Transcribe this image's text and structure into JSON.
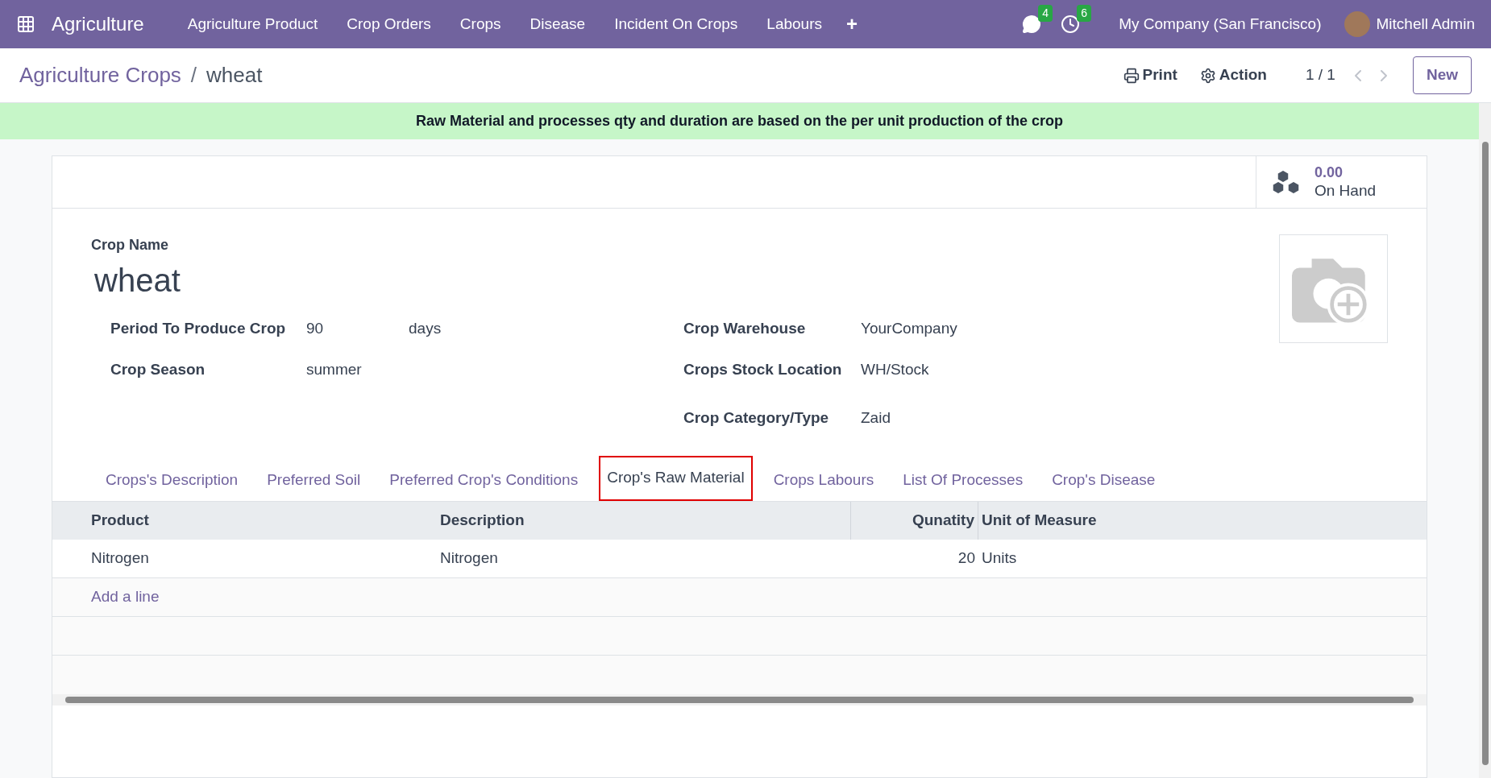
{
  "navbar": {
    "app_name": "Agriculture",
    "menus": [
      "Agriculture Product",
      "Crop Orders",
      "Crops",
      "Disease",
      "Incident On Crops",
      "Labours"
    ],
    "add_symbol": "+",
    "messages_count": "4",
    "activities_count": "6",
    "company": "My Company (San Francisco)",
    "user": "Mitchell Admin"
  },
  "control_panel": {
    "breadcrumb": "Agriculture Crops",
    "separator": "/",
    "current": "wheat",
    "print": "Print",
    "action": "Action",
    "pager": "1 / 1",
    "new_button": "New"
  },
  "banner": {
    "text": "Raw Material and processes qty and duration are based on the per unit production of the crop"
  },
  "stat_button": {
    "value": "0.00",
    "label": "On Hand"
  },
  "form": {
    "name_label": "Crop Name",
    "name": "wheat",
    "left_fields": [
      {
        "label": "Period To Produce Crop",
        "value": "90",
        "unit": "days"
      },
      {
        "label": "Crop Season",
        "value": "summer"
      }
    ],
    "right_fields": [
      {
        "label": "Crop Warehouse",
        "value": "YourCompany"
      },
      {
        "label": "Crops Stock Location",
        "value": "WH/Stock"
      },
      {
        "label": "Crop Category/Type",
        "value": "Zaid"
      }
    ]
  },
  "tabs": [
    {
      "label": "Crops's Description",
      "selected": false
    },
    {
      "label": "Preferred Soil",
      "selected": false
    },
    {
      "label": "Preferred Crop's Conditions",
      "selected": false
    },
    {
      "label": "Crop's Raw Material",
      "selected": true
    },
    {
      "label": "Crops Labours",
      "selected": false
    },
    {
      "label": "List Of Processes",
      "selected": false
    },
    {
      "label": "Crop's Disease",
      "selected": false
    }
  ],
  "table": {
    "columns": [
      "Product",
      "Description",
      "Qunatity",
      "Unit of Measure"
    ],
    "rows": [
      [
        "Nitrogen",
        "Nitrogen",
        "20",
        "Units"
      ]
    ],
    "add_line": "Add a line"
  }
}
